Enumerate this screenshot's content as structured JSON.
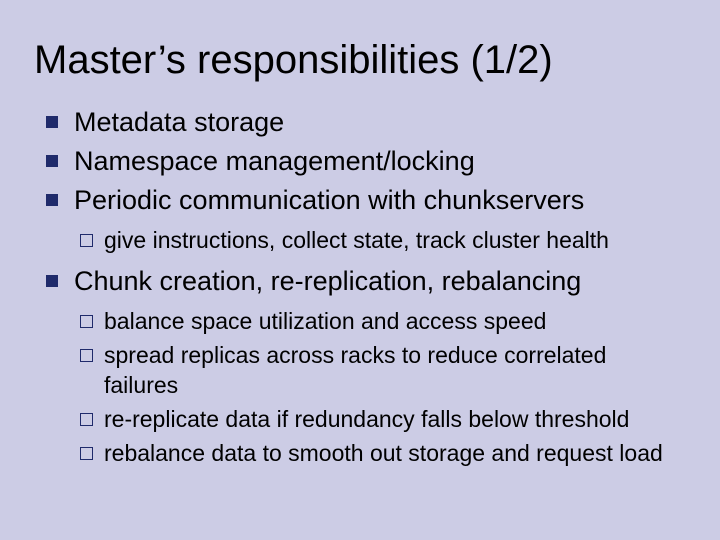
{
  "title": "Master’s responsibilities (1/2)",
  "bullets": [
    {
      "text": "Metadata storage"
    },
    {
      "text": "Namespace management/locking"
    },
    {
      "text": "Periodic communication with chunkservers",
      "sub": [
        "give instructions, collect state, track cluster health"
      ]
    },
    {
      "text": "Chunk creation, re-replication, rebalancing",
      "sub": [
        "balance space utilization and access speed",
        "spread replicas across racks to reduce correlated failures",
        "re-replicate data if redundancy falls below threshold",
        "rebalance data to smooth out storage and request load"
      ]
    }
  ]
}
